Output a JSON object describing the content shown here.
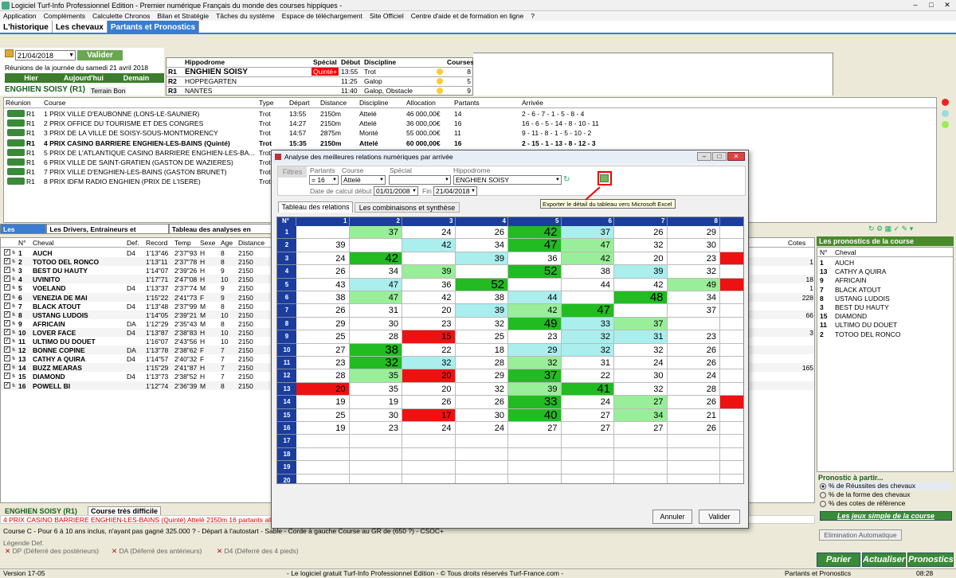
{
  "window": {
    "title": "Logiciel Turf-Info Professionnel Edition - Premier numérique Français du monde des courses hippiques -"
  },
  "menu": [
    "Application",
    "Compléments",
    "Calculette Chronos",
    "Bilan et Stratégie",
    "Tâches du système",
    "Espace de téléchargement",
    "Site Officiel",
    "Centre d'aide et de formation en ligne",
    "?"
  ],
  "tabs": [
    "L'historique",
    "Les chevaux",
    "Partants et Pronostics"
  ],
  "datepanel": {
    "date": "21/04/2018",
    "validate": "Valider",
    "reunions": "Réunions de la journée du samedi 21 avril 2018",
    "hier": "Hier",
    "aujourdhui": "Aujourd'hui",
    "demain": "Demain",
    "venue": "ENGHIEN SOISY (R1)",
    "terrain": "Terrain Bon"
  },
  "hippo": {
    "headers": [
      "Hippodrome",
      "Spécial",
      "Début",
      "Discipline",
      "Courses"
    ],
    "rows": [
      {
        "r": "R1",
        "name": "ENGHIEN SOISY",
        "special": "Quinté+",
        "debut": "13:55",
        "disc": "Trot",
        "n": "8"
      },
      {
        "r": "R2",
        "name": "HOPPEGARTEN",
        "special": "",
        "debut": "11:25",
        "disc": "Galop",
        "n": "5"
      },
      {
        "r": "R3",
        "name": "NANTES",
        "special": "",
        "debut": "11:40",
        "disc": "Galop, Obstacle",
        "n": "9"
      }
    ]
  },
  "races": {
    "headers": [
      "Réunion",
      "Course",
      "Type",
      "Départ",
      "Distance",
      "Discipline",
      "Allocation",
      "Partants",
      "Arrivée"
    ],
    "rows": [
      {
        "r": "R1",
        "c": "1 PRIX VILLE D'EAUBONNE (LONS-LE-SAUNIER)",
        "t": "Trot",
        "d": "13:55",
        "dist": "2150m",
        "disc": "Attelé",
        "a": "46 000,00€",
        "p": "14",
        "arr": "2 - 6 - 7 - 1 - 5 - 8 - 4"
      },
      {
        "r": "R1",
        "c": "2 PRIX OFFICE DU TOURISME ET DES CONGRES",
        "t": "Trot",
        "d": "14:27",
        "dist": "2150m",
        "disc": "Attelé",
        "a": "36 000,00€",
        "p": "16",
        "arr": "16 - 6 - 5 - 14 - 8 - 10 - 11"
      },
      {
        "r": "R1",
        "c": "3 PRIX DE LA VILLE DE SOISY-SOUS-MONTMORENCY",
        "t": "Trot",
        "d": "14:57",
        "dist": "2875m",
        "disc": "Monté",
        "a": "55 000,00€",
        "p": "11",
        "arr": "9 - 11 - 8 - 1 - 5 - 10 - 2"
      },
      {
        "r": "R1",
        "c": "4 PRIX CASINO BARRIERE ENGHIEN-LES-BAINS (Quinté)",
        "t": "Trot",
        "d": "15:35",
        "dist": "2150m",
        "disc": "Attelé",
        "a": "60 000,00€",
        "p": "16",
        "arr": "2 - 15 - 1 - 13 - 8 - 12 - 3"
      },
      {
        "r": "R1",
        "c": "5 PRIX DE L'ATLANTIQUE CASINO BARRIERE ENGHIEN-LES-BA...",
        "t": "Trot",
        "d": "",
        "dist": "",
        "disc": "",
        "a": "",
        "p": "",
        "arr": ""
      },
      {
        "r": "R1",
        "c": "6 PRIX VILLE DE SAINT-GRATIEN (GASTON DE WAZIERES)",
        "t": "Trot",
        "d": "",
        "dist": "",
        "disc": "",
        "a": "",
        "p": "",
        "arr": ""
      },
      {
        "r": "R1",
        "c": "7 PRIX VILLE D'ENGHIEN-LES-BAINS (GASTON BRUNET)",
        "t": "Trot",
        "d": "",
        "dist": "",
        "disc": "",
        "a": "",
        "p": "",
        "arr": ""
      },
      {
        "r": "R1",
        "c": "8 PRIX IDFM RADIO ENGHIEN (PRIX DE L'ISERE)",
        "t": "Trot",
        "d": "",
        "dist": "",
        "disc": "",
        "a": "",
        "p": "",
        "arr": ""
      }
    ]
  },
  "midtabs": [
    "Les partants",
    "Les Drivers, Entraineurs et Chevaux",
    "Tableau des analyses en Attelé"
  ],
  "partants": {
    "headers": [
      "N°",
      "Cheval",
      "Def.",
      "Record",
      "Temp",
      "Sexe",
      "Age",
      "Distance"
    ],
    "cotesHeader": "Cotes De",
    "rows": [
      {
        "n": "1",
        "c": "AUCH",
        "def": "D4",
        "rec": "1'13\"46",
        "temp": "2'37\"93",
        "s": "H",
        "a": "8",
        "d": "2150"
      },
      {
        "n": "2",
        "c": "TOTOO DEL RONCO",
        "def": "",
        "rec": "1'13\"11",
        "temp": "2'37\"78",
        "s": "H",
        "a": "8",
        "d": "2150"
      },
      {
        "n": "3",
        "c": "BEST DU HAUTY",
        "def": "",
        "rec": "1'14\"07",
        "temp": "2'39\"26",
        "s": "H",
        "a": "9",
        "d": "2150"
      },
      {
        "n": "4",
        "c": "UVINITO",
        "def": "",
        "rec": "1'17\"71",
        "temp": "2'47\"08",
        "s": "H",
        "a": "10",
        "d": "2150"
      },
      {
        "n": "5",
        "c": "VOELAND",
        "def": "D4",
        "rec": "1'13\"37",
        "temp": "2'37\"74",
        "s": "M",
        "a": "9",
        "d": "2150"
      },
      {
        "n": "6",
        "c": "VENEZIA DE MAI",
        "def": "",
        "rec": "1'15\"22",
        "temp": "2'41\"73",
        "s": "F",
        "a": "9",
        "d": "2150"
      },
      {
        "n": "7",
        "c": "BLACK ATOUT",
        "def": "D4",
        "rec": "1'13\"48",
        "temp": "2'37\"99",
        "s": "M",
        "a": "8",
        "d": "2150"
      },
      {
        "n": "8",
        "c": "USTANG LUDOIS",
        "def": "",
        "rec": "1'14\"05",
        "temp": "2'39\"21",
        "s": "M",
        "a": "10",
        "d": "2150"
      },
      {
        "n": "9",
        "c": "AFRICAIN",
        "def": "DA",
        "rec": "1'12\"29",
        "temp": "2'35\"43",
        "s": "M",
        "a": "8",
        "d": "2150"
      },
      {
        "n": "10",
        "c": "LOVER FACE",
        "def": "D4",
        "rec": "1'13\"87",
        "temp": "2'38\"83",
        "s": "H",
        "a": "10",
        "d": "2150"
      },
      {
        "n": "11",
        "c": "ULTIMO DU DOUET",
        "def": "",
        "rec": "1'16\"07",
        "temp": "2'43\"56",
        "s": "H",
        "a": "10",
        "d": "2150"
      },
      {
        "n": "12",
        "c": "BONNE COPINE",
        "def": "DA",
        "rec": "1'13\"78",
        "temp": "2'38\"62",
        "s": "F",
        "a": "7",
        "d": "2150"
      },
      {
        "n": "13",
        "c": "CATHY A QUIRA",
        "def": "D4",
        "rec": "1'14\"57",
        "temp": "2'40\"32",
        "s": "F",
        "a": "7",
        "d": "2150"
      },
      {
        "n": "14",
        "c": "BUZZ MEARAS",
        "def": "",
        "rec": "1'15\"29",
        "temp": "2'41\"87",
        "s": "H",
        "a": "7",
        "d": "2150"
      },
      {
        "n": "15",
        "c": "DIAMOND",
        "def": "D4",
        "rec": "1'13\"73",
        "temp": "2'38\"52",
        "s": "H",
        "a": "7",
        "d": "2150"
      },
      {
        "n": "16",
        "c": "POWELL BI",
        "def": "",
        "rec": "1'12\"74",
        "temp": "2'36\"39",
        "s": "M",
        "a": "8",
        "d": "2150"
      }
    ]
  },
  "cotes": [
    "",
    "1",
    "",
    "18",
    "1",
    "228",
    "",
    "66",
    "",
    "3",
    "",
    "",
    "",
    "165",
    "",
    ""
  ],
  "pronos": {
    "title": "Les pronostics de la course",
    "headers": [
      "N°",
      "Cheval"
    ],
    "rows": [
      {
        "n": "1",
        "c": "AUCH"
      },
      {
        "n": "13",
        "c": "CATHY A QUIRA"
      },
      {
        "n": "9",
        "c": "AFRICAIN"
      },
      {
        "n": "7",
        "c": "BLACK ATOUT"
      },
      {
        "n": "8",
        "c": "USTANG LUDOIS"
      },
      {
        "n": "3",
        "c": "BEST DU HAUTY"
      },
      {
        "n": "15",
        "c": "DIAMOND"
      },
      {
        "n": "11",
        "c": "ULTIMO DU DOUET"
      },
      {
        "n": "2",
        "c": "TOTOO DEL RONCO"
      }
    ],
    "partir": "Pronostic à partir...",
    "opts": [
      "% de Réussites des chevaux",
      "% de la forme des chevaux",
      "% des cotes de référence"
    ],
    "jeux": "Les jeux simple de la course",
    "elim": "Elimination Automatique",
    "parier": "Parier",
    "actualiser": "Actualiser",
    "pronostics": "Pronostics"
  },
  "bottom": {
    "venue": "ENGHIEN SOISY (R1)",
    "tab": "Course très difficile",
    "race": "4 PRIX CASINO BARRIERE ENGHIEN-LES-BAINS (Quinté) Attelé 2150m 16 partants allocation de",
    "cond": "Course C - Pour 6 à 10 ans inclus, n'ayant pas gagné 325.000 ? - Départ à l'autostart - Sable - Corde à gauche  Course au GR de (650 ?) - CSOC+",
    "legend": "Légende Def.",
    "dp": "DP (Déferré des postérieurs)",
    "da": "DA (Déferré des antérieurs)",
    "d4": "D4 (Déferré des 4 pieds)"
  },
  "status": {
    "version": "Version 17-05",
    "center": "- Le logiciel gratuit Turf-Info Professionnel Edition - © Tous droits réservés Turf-France.com -",
    "section": "Partants et Pronostics",
    "time": "08:28"
  },
  "dialog": {
    "title": "Analyse des meilleures relations numériques par arrivée",
    "filtres": "Filtres",
    "lPartants": "Partants",
    "lCourse": "Course",
    "lSpecial": "Spécial",
    "lHippo": "Hippodrome",
    "partants": "= 16",
    "course": "Attelé",
    "special": "",
    "hippo": "ENGHIEN SOISY",
    "lDate": "Date de calcul début",
    "dateDebut": "01/01/2008",
    "lFin": "Fin",
    "dateFin": "21/04/2018",
    "tooltip": "Exporter le détail du tableau vers Microsoft Excel",
    "tab1": "Tableau des relations",
    "tab2": "Les combinaisons et synthèse",
    "annuler": "Annuler",
    "valider": "Valider",
    "corner": "N°"
  },
  "grid": {
    "cols": [
      "1",
      "2",
      "3",
      "4",
      "5",
      "6",
      "7",
      "8"
    ],
    "rows": [
      [
        "",
        "37",
        "24",
        "26",
        "42",
        "37",
        "26",
        "29"
      ],
      [
        "39",
        "",
        "42",
        "34",
        "47",
        "47",
        "32",
        "30"
      ],
      [
        "24",
        "42",
        "",
        "39",
        "36",
        "42",
        "20",
        "23"
      ],
      [
        "26",
        "34",
        "39",
        "",
        "52",
        "38",
        "39",
        "32"
      ],
      [
        "43",
        "47",
        "36",
        "52",
        "",
        "44",
        "42",
        "49"
      ],
      [
        "38",
        "47",
        "42",
        "38",
        "44",
        "",
        "48",
        "34"
      ],
      [
        "26",
        "31",
        "20",
        "39",
        "42",
        "47",
        "",
        "37"
      ],
      [
        "29",
        "30",
        "23",
        "32",
        "49",
        "33",
        "37",
        ""
      ],
      [
        "25",
        "28",
        "15",
        "25",
        "23",
        "32",
        "31",
        "23"
      ],
      [
        "27",
        "38",
        "22",
        "18",
        "29",
        "32",
        "32",
        "26"
      ],
      [
        "23",
        "32",
        "32",
        "28",
        "32",
        "31",
        "24",
        "26"
      ],
      [
        "28",
        "35",
        "20",
        "29",
        "37",
        "22",
        "30",
        "24"
      ],
      [
        "20",
        "35",
        "20",
        "32",
        "39",
        "41",
        "32",
        "28"
      ],
      [
        "19",
        "19",
        "26",
        "26",
        "33",
        "24",
        "27",
        "26"
      ],
      [
        "25",
        "30",
        "17",
        "30",
        "40",
        "27",
        "34",
        "21"
      ],
      [
        "19",
        "23",
        "24",
        "24",
        "27",
        "27",
        "27",
        "26"
      ],
      [
        "",
        "",
        "",
        "",
        "",
        "",
        "",
        ""
      ],
      [
        "",
        "",
        "",
        "",
        "",
        "",
        "",
        ""
      ],
      [
        "",
        "",
        "",
        "",
        "",
        "",
        "",
        ""
      ],
      [
        "",
        "",
        "",
        "",
        "",
        "",
        "",
        ""
      ]
    ],
    "colors": [
      [
        "",
        "lg",
        "",
        "",
        "dg",
        "lb",
        "",
        ""
      ],
      [
        "",
        "",
        "lb",
        "",
        "dg",
        "lg",
        "",
        ""
      ],
      [
        "",
        "dg",
        "",
        "lb",
        "",
        "lg",
        "",
        ""
      ],
      [
        "",
        "",
        "lg",
        "",
        "dg",
        "",
        "lb",
        ""
      ],
      [
        "",
        "lb",
        "",
        "dg",
        "",
        "",
        "",
        "lg"
      ],
      [
        "",
        "lg",
        "",
        "",
        "lb",
        "",
        "dg",
        ""
      ],
      [
        "",
        "",
        "",
        "lb",
        "lg",
        "dg",
        "",
        ""
      ],
      [
        "",
        "",
        "",
        "",
        "dg",
        "lb",
        "lg",
        ""
      ],
      [
        "",
        "",
        "r",
        "",
        "",
        "lb",
        "lb",
        ""
      ],
      [
        "",
        "dg",
        "",
        "",
        "lb",
        "lb",
        "",
        ""
      ],
      [
        "",
        "dg",
        "lb",
        "",
        "lg",
        "",
        "",
        ""
      ],
      [
        "",
        "lg",
        "r",
        "",
        "dg",
        "",
        "",
        ""
      ],
      [
        "r",
        "",
        "",
        "",
        "lg",
        "dg",
        "",
        ""
      ],
      [
        "",
        "",
        "",
        "",
        "dg",
        "",
        "lg",
        ""
      ],
      [
        "",
        "",
        "r",
        "",
        "dg",
        "",
        "lg",
        ""
      ],
      [
        "",
        "",
        "",
        "",
        "",
        "",
        "",
        ""
      ],
      [
        "",
        "",
        "",
        "",
        "",
        "",
        "",
        ""
      ],
      [
        "",
        "",
        "",
        "",
        "",
        "",
        "",
        ""
      ],
      [
        "",
        "",
        "",
        "",
        "",
        "",
        "",
        ""
      ],
      [
        "",
        "",
        "",
        "",
        "",
        "",
        "",
        ""
      ]
    ],
    "extra": [
      "",
      "",
      "r",
      "",
      "r",
      "",
      "",
      "",
      "",
      "",
      "",
      "",
      "",
      "r",
      "",
      ""
    ]
  },
  "palette": {
    "lg": "#99ee99",
    "dg": "#22bb22",
    "lb": "#aaeeee",
    "r": "#ee1111",
    "hdr": "#1a3d9e",
    "green": "#3b7d2c"
  }
}
